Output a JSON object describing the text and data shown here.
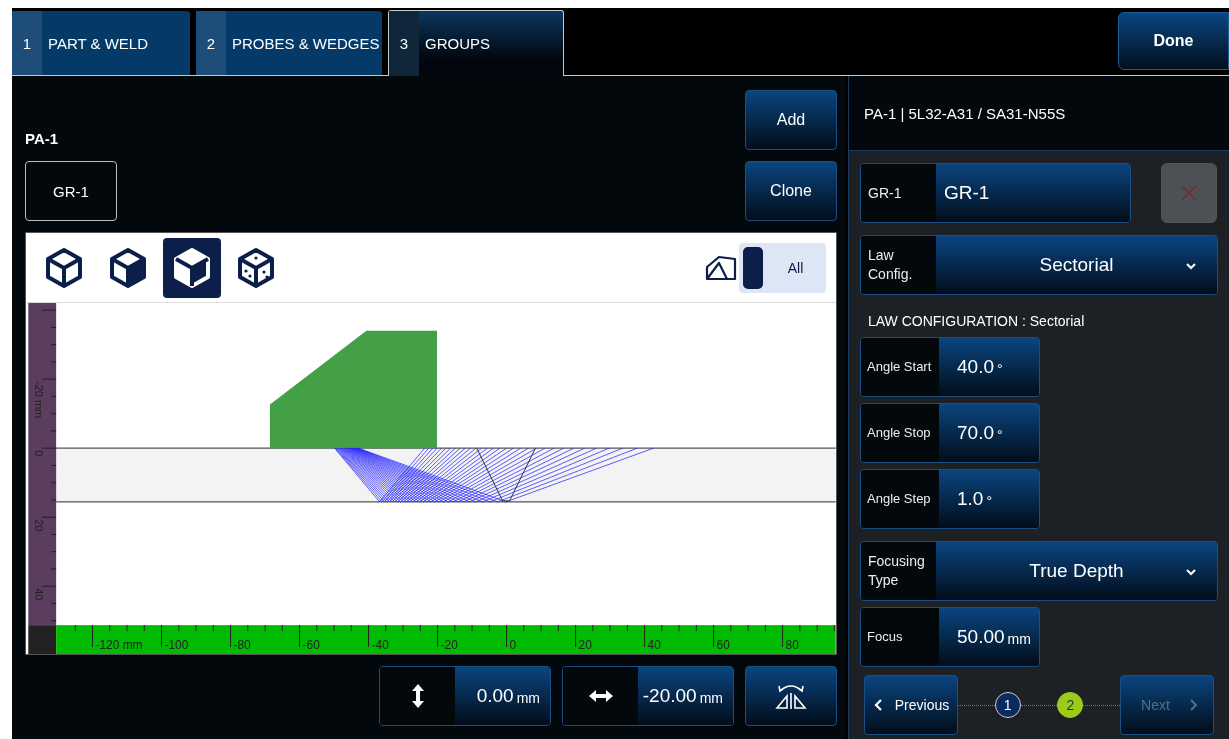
{
  "tabs": [
    {
      "number": "1",
      "label": "PART & WELD",
      "selected": false
    },
    {
      "number": "2",
      "label": "PROBES & WEDGES",
      "selected": false
    },
    {
      "number": "3",
      "label": "GROUPS",
      "selected": true
    }
  ],
  "done_button": "Done",
  "probe": {
    "label": "PA-1",
    "group_button": "GR-1"
  },
  "actions": [
    "Add",
    "Clone"
  ],
  "viewer": {
    "views": [
      {
        "selected": false
      },
      {
        "selected": false
      },
      {
        "selected": true
      },
      {
        "selected": false
      }
    ],
    "toggle": {
      "label": "All",
      "on": false
    },
    "depth_ruler": [
      "-20 mm",
      "0",
      "20",
      "40"
    ],
    "index_ruler": [
      "-120 mm",
      "-100",
      "-80",
      "-60",
      "-40",
      "-20",
      "0",
      "20",
      "40",
      "60",
      "80"
    ]
  },
  "offsets": [
    {
      "kind": "vertical",
      "value": "0.00",
      "unit": "mm"
    },
    {
      "kind": "horizontal",
      "value": "-20.00",
      "unit": "mm"
    }
  ],
  "panel": {
    "title": "PA-1 | 5L32-A31 / SA31-N55S",
    "name_field": {
      "label": "GR-1",
      "value": "GR-1"
    },
    "delete_disabled": true,
    "fields": [
      {
        "kind": "dropdown",
        "label": "Law Config.",
        "value": "Sectorial"
      },
      {
        "kind": "heading",
        "text": "LAW CONFIGURATION : Sectorial"
      },
      {
        "kind": "number",
        "label": "Angle Start",
        "value": "40.0",
        "unit": "°"
      },
      {
        "kind": "number",
        "label": "Angle Stop",
        "value": "70.0",
        "unit": "°"
      },
      {
        "kind": "number",
        "label": "Angle Step",
        "value": "1.0",
        "unit": "°"
      },
      {
        "kind": "dropdown",
        "label": "Focusing Type",
        "value": "True Depth"
      },
      {
        "kind": "number",
        "label": "Focus",
        "value": "50.00",
        "unit": "mm"
      }
    ],
    "pager": {
      "previous": "Previous",
      "next": "Next",
      "next_disabled": true,
      "steps": [
        {
          "label": "1",
          "selected": false
        },
        {
          "label": "2",
          "selected": true
        }
      ]
    }
  }
}
